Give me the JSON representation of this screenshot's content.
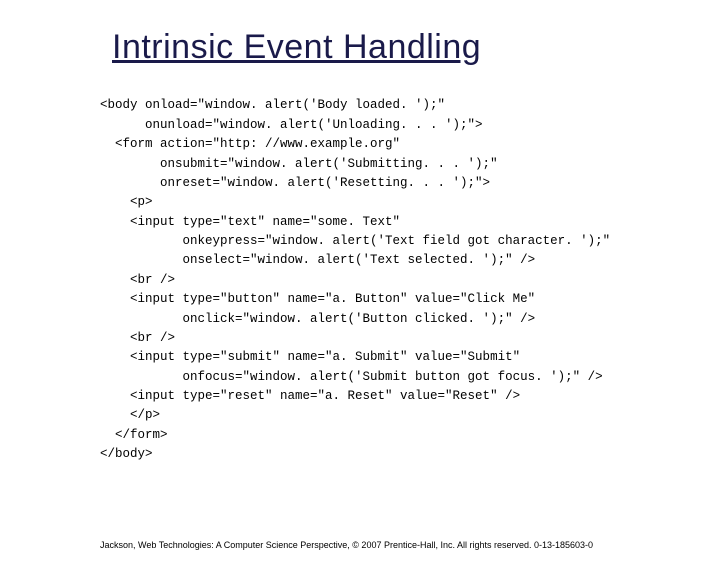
{
  "title": "Intrinsic Event Handling",
  "code": {
    "l1": "<body onload=\"window. alert('Body loaded. ');\"",
    "l2": "      onunload=\"window. alert('Unloading. . . ');\">",
    "l3": "  <form action=\"http: //www.example.org\"",
    "l4": "        onsubmit=\"window. alert('Submitting. . . ');\"",
    "l5": "        onreset=\"window. alert('Resetting. . . ');\">",
    "l6": "    <p>",
    "l7": "    <input type=\"text\" name=\"some. Text\"",
    "l8": "           onkeypress=\"window. alert('Text field got character. ');\"",
    "l9": "           onselect=\"window. alert('Text selected. ');\" />",
    "l10": "    <br />",
    "l11": "    <input type=\"button\" name=\"a. Button\" value=\"Click Me\"",
    "l12": "           onclick=\"window. alert('Button clicked. ');\" />",
    "l13": "    <br />",
    "l14": "    <input type=\"submit\" name=\"a. Submit\" value=\"Submit\"",
    "l15": "           onfocus=\"window. alert('Submit button got focus. ');\" />",
    "l16": "    <input type=\"reset\" name=\"a. Reset\" value=\"Reset\" />",
    "l17": "    </p>",
    "l18": "  </form>",
    "l19": "</body>"
  },
  "footer": "Jackson, Web Technologies: A Computer Science Perspective, © 2007 Prentice-Hall, Inc. All rights reserved. 0-13-185603-0"
}
